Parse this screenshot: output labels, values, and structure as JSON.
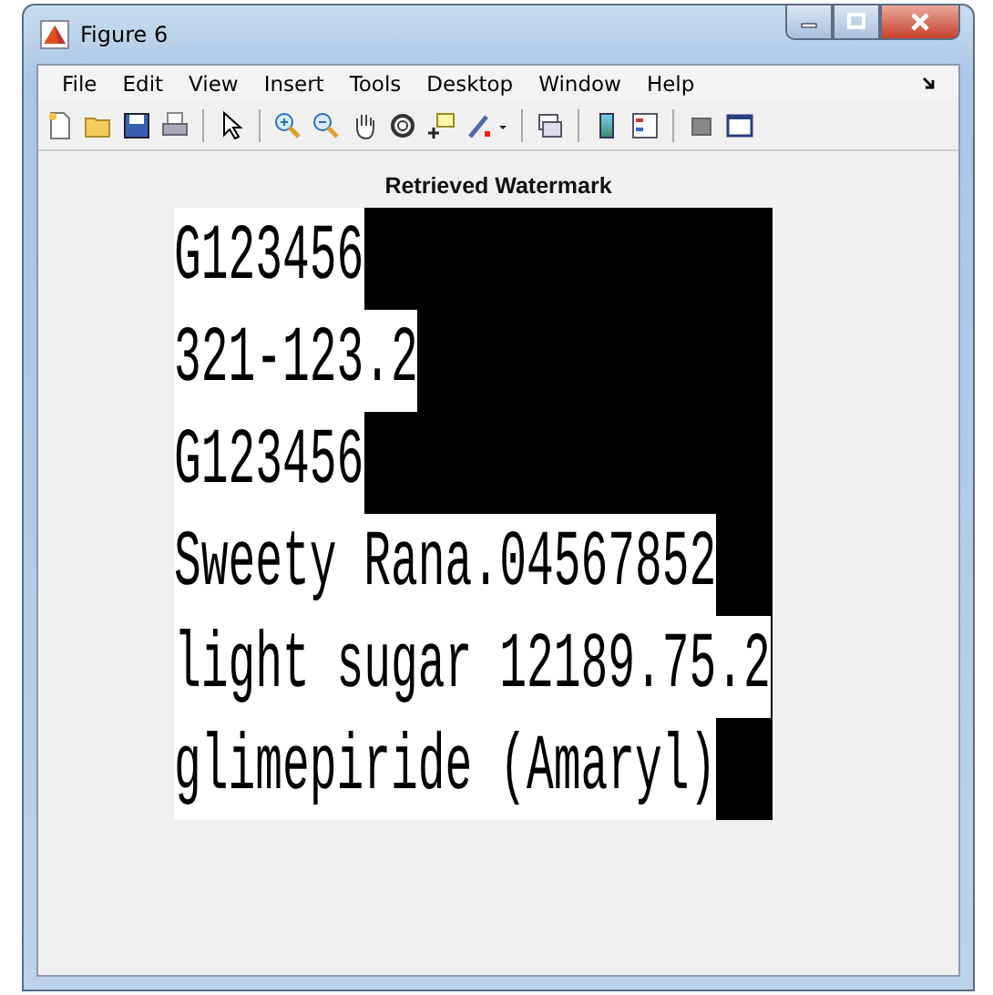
{
  "window": {
    "title": "Figure 6"
  },
  "menu": [
    "File",
    "Edit",
    "View",
    "Insert",
    "Tools",
    "Desktop",
    "Window",
    "Help"
  ],
  "axes": {
    "title": "Retrieved Watermark",
    "rows": [
      "G123456",
      "321-123.2",
      "G123456",
      "Sweety Rana.04567852",
      "light sugar 12189.75.2",
      "glimepiride (Amaryl)"
    ]
  }
}
